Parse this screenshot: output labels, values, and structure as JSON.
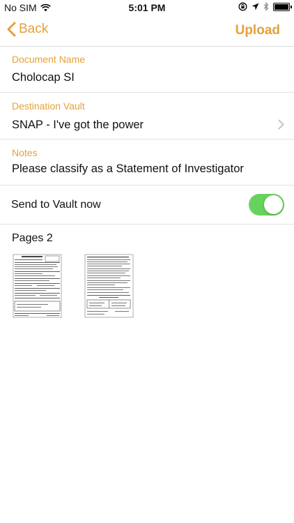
{
  "status": {
    "carrier": "No SIM",
    "time": "5:01 PM"
  },
  "nav": {
    "back_label": "Back",
    "upload_label": "Upload"
  },
  "form": {
    "document_name": {
      "label": "Document Name",
      "value": "Cholocap SI"
    },
    "destination_vault": {
      "label": "Destination Vault",
      "value": "SNAP - I've got the power"
    },
    "notes": {
      "label": "Notes",
      "value": "Please classify as a Statement of Investigator"
    }
  },
  "send": {
    "label": "Send to Vault now",
    "enabled": true
  },
  "pages": {
    "label": "Pages 2"
  },
  "colors": {
    "accent": "#e4a13a",
    "toggle_on": "#67d35e"
  },
  "icons": [
    "wifi-icon",
    "lock-rotation-icon",
    "location-icon",
    "bluetooth-icon",
    "battery-icon",
    "chevron-left-icon",
    "chevron-right-icon"
  ]
}
